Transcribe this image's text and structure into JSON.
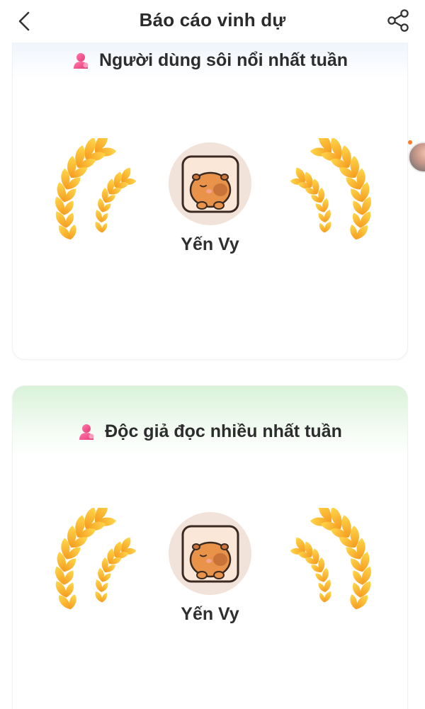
{
  "header": {
    "title": "Báo cáo vinh dự",
    "back_icon": "chevron-left-icon",
    "share_icon": "share-icon"
  },
  "cards": [
    {
      "title": "Người dùng sôi nổi nhất tuần",
      "icon": "user-icon",
      "user_name": "Yến Vy",
      "header_color": "#eaf1fc"
    },
    {
      "title": "Độc giả đọc nhiều nhất tuần",
      "icon": "user-icon",
      "user_name": "Yến Vy",
      "header_color": "#d9f2d9"
    }
  ],
  "colors": {
    "laurel_light": "#ffd84a",
    "laurel_dark": "#f59a1f",
    "user_icon": "#ef5a93",
    "avatar_bg": "#f2e3da",
    "capybara": "#e8924a"
  }
}
